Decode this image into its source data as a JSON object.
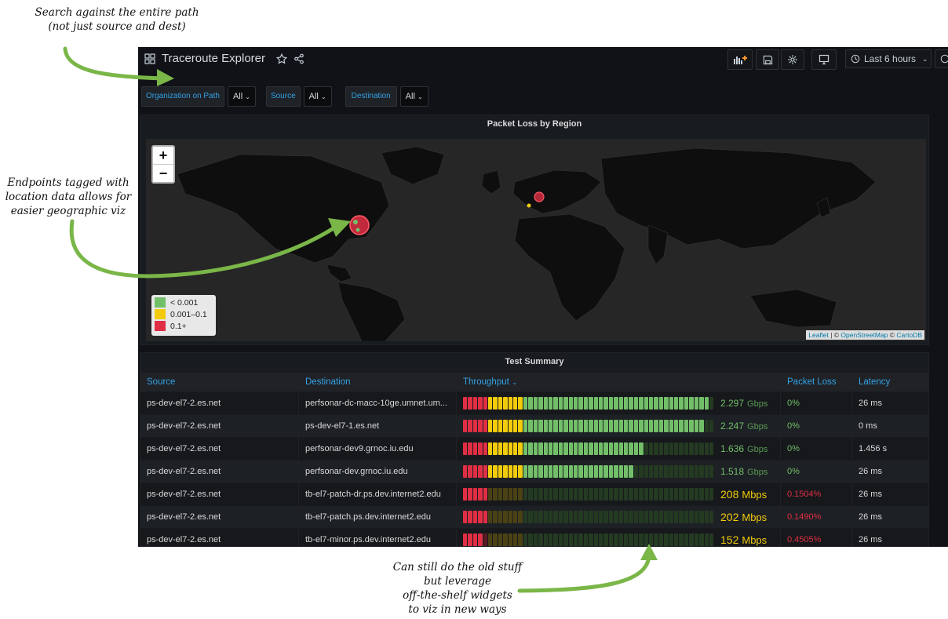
{
  "annotations": {
    "search": [
      "Search against the entire path",
      "(not just source and dest)"
    ],
    "endpoints": [
      "Endpoints tagged with",
      "location data allows for",
      "easier geographic viz"
    ],
    "widgets": [
      "Can still do the old stuff",
      "but leverage",
      "off-the-shelf widgets",
      "to viz in new ways"
    ]
  },
  "dashboard": {
    "title": "Traceroute Explorer",
    "time_range": "Last 6 hours"
  },
  "variables": [
    {
      "label": "Organization on Path",
      "value": "All"
    },
    {
      "label": "Source",
      "value": "All"
    },
    {
      "label": "Destination",
      "value": "All"
    }
  ],
  "map_panel": {
    "title": "Packet Loss by Region",
    "zoom_in": "+",
    "zoom_out": "−",
    "legend": [
      {
        "label": "< 0.001",
        "color": "#73bf69"
      },
      {
        "label": "0.001–0.1",
        "color": "#f2cc0c"
      },
      {
        "label": "0.1+",
        "color": "#e02f44"
      }
    ],
    "attribution": {
      "leaflet": "Leaflet",
      "osm": "OpenStreetMap",
      "carto": "CartoDB"
    }
  },
  "table_panel": {
    "title": "Test Summary",
    "columns": {
      "source": "Source",
      "destination": "Destination",
      "throughput": "Throughput",
      "loss": "Packet Loss",
      "latency": "Latency"
    },
    "rows": [
      {
        "source": "ps-dev-el7-2.es.net",
        "destination": "perfsonar-dc-macc-10ge.umnet.um...",
        "throughput_num": "2.297",
        "throughput_unit": "Gbps",
        "throughput_fraction": 0.97,
        "loss": "0%",
        "latency": "26 ms"
      },
      {
        "source": "ps-dev-el7-2.es.net",
        "destination": "ps-dev-el7-1.es.net",
        "throughput_num": "2.247",
        "throughput_unit": "Gbps",
        "throughput_fraction": 0.95,
        "loss": "0%",
        "latency": "0 ms"
      },
      {
        "source": "ps-dev-el7-2.es.net",
        "destination": "perfsonar-dev9.grnoc.iu.edu",
        "throughput_num": "1.636",
        "throughput_unit": "Gbps",
        "throughput_fraction": 0.71,
        "loss": "0%",
        "latency": "1.456 s"
      },
      {
        "source": "ps-dev-el7-2.es.net",
        "destination": "perfsonar-dev.grnoc.iu.edu",
        "throughput_num": "1.518",
        "throughput_unit": "Gbps",
        "throughput_fraction": 0.67,
        "loss": "0%",
        "latency": "26 ms"
      },
      {
        "source": "ps-dev-el7-2.es.net",
        "destination": "tb-el7-patch-dr.ps.dev.internet2.edu",
        "throughput_num": "208",
        "throughput_unit": "Mbps",
        "throughput_fraction": 0.1,
        "loss": "0.1504%",
        "latency": "26 ms"
      },
      {
        "source": "ps-dev-el7-2.es.net",
        "destination": "tb-el7-patch.ps.dev.internet2.edu",
        "throughput_num": "202",
        "throughput_unit": "Mbps",
        "throughput_fraction": 0.09,
        "loss": "0.1490%",
        "latency": "26 ms"
      },
      {
        "source": "ps-dev-el7-2.es.net",
        "destination": "tb-el7-minor.ps.dev.internet2.edu",
        "throughput_num": "152",
        "throughput_unit": "Mbps",
        "throughput_fraction": 0.07,
        "loss": "0.4505%",
        "latency": "26 ms"
      }
    ]
  }
}
